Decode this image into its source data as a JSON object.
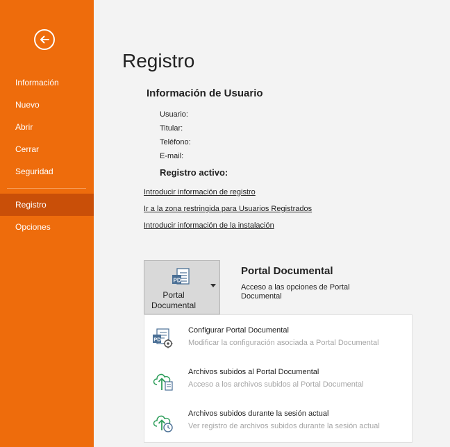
{
  "sidebar": {
    "back_icon": "back-arrow-icon",
    "items": [
      {
        "label": "Información",
        "active": false
      },
      {
        "label": "Nuevo",
        "active": false
      },
      {
        "label": "Abrir",
        "active": false
      },
      {
        "label": "Cerrar",
        "active": false
      },
      {
        "label": "Seguridad",
        "active": false
      },
      {
        "label": "Registro",
        "active": true
      },
      {
        "label": "Opciones",
        "active": false
      }
    ]
  },
  "main": {
    "page_title": "Registro",
    "user_info": {
      "title": "Información de Usuario",
      "fields": [
        {
          "label": "Usuario:"
        },
        {
          "label": "Titular:"
        },
        {
          "label": "Teléfono:"
        },
        {
          "label": "E-mail:"
        }
      ],
      "registro_activo": "Registro activo:"
    },
    "links": [
      "Introducir información de registro",
      "Ir a la zona restringida para Usuarios Registrados",
      "Introducir información de la instalación"
    ],
    "portal": {
      "button_label_line1": "Portal",
      "button_label_line2": "Documental",
      "title": "Portal Documental",
      "description": "Acceso a las opciones de Portal Documental",
      "menu": [
        {
          "title": "Configurar Portal Documental",
          "description": "Modificar la configuración asociada a Portal Documental",
          "icon": "configure-portal-icon"
        },
        {
          "title": "Archivos subidos al Portal Documental",
          "description": "Acceso a los archivos subidos al Portal Documental",
          "icon": "cloud-upload-icon"
        },
        {
          "title": "Archivos subidos durante la sesión actual",
          "description": "Ver registro de archivos subidos durante la sesión actual",
          "icon": "cloud-upload-clock-icon"
        }
      ]
    }
  },
  "colors": {
    "sidebar_bg": "#ee6c0c",
    "sidebar_active": "#c94f08",
    "icon_green": "#2e9e5b",
    "icon_blue": "#4a6f95"
  }
}
